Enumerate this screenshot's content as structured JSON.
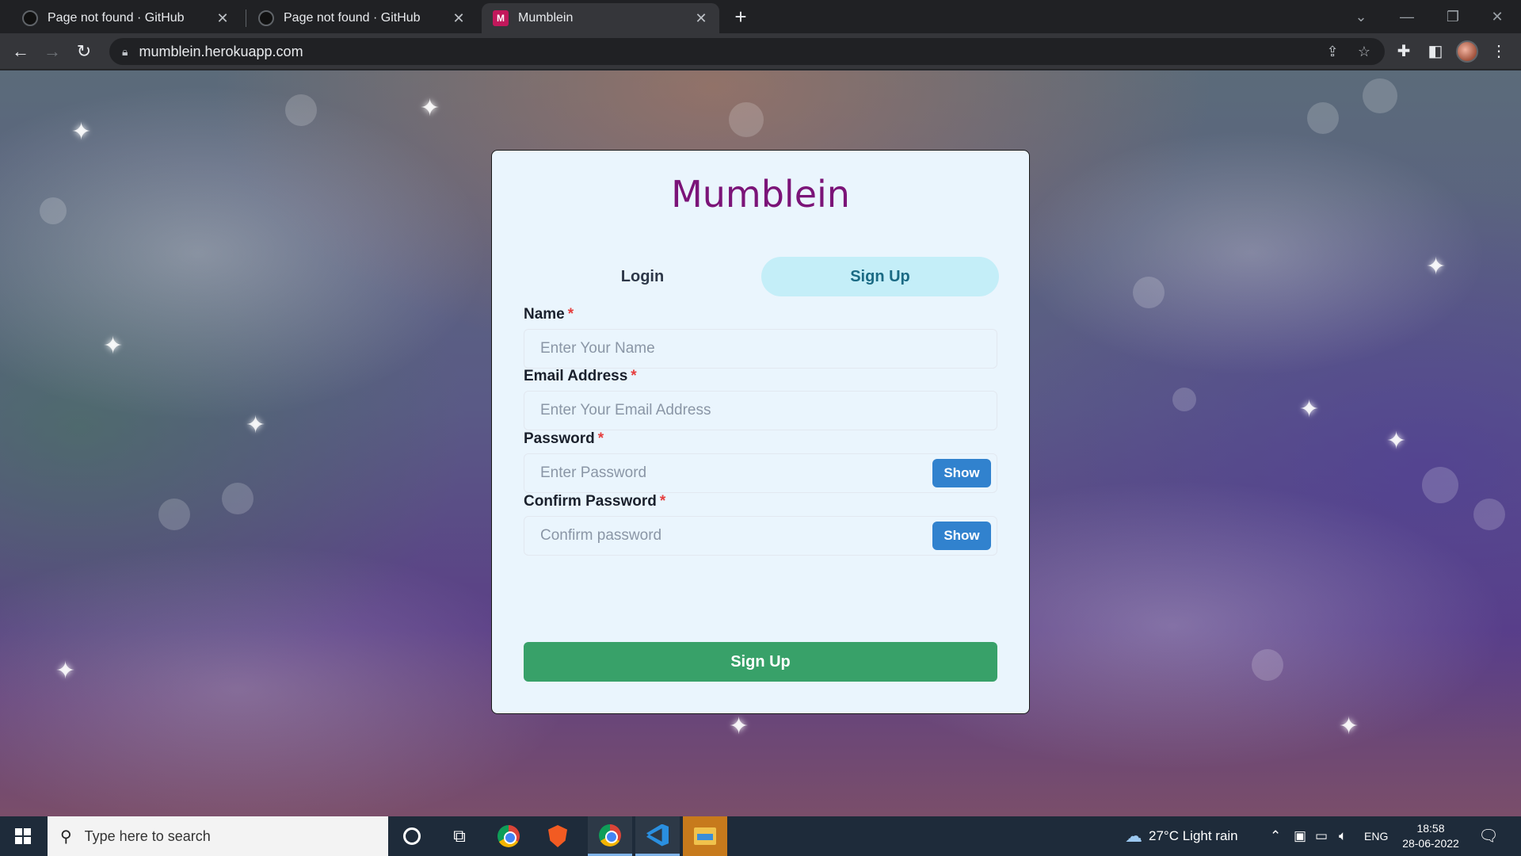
{
  "browser": {
    "tabs": [
      {
        "title": "Page not found · GitHub",
        "active": false
      },
      {
        "title": "Page not found · GitHub",
        "active": false
      },
      {
        "title": "Mumblein",
        "active": true
      }
    ],
    "url": "mumblein.herokuapp.com"
  },
  "app": {
    "brand": "Mumblein",
    "tabs": {
      "login": "Login",
      "signup": "Sign Up"
    },
    "fields": [
      {
        "label": "Name",
        "required": "*",
        "placeholder": "Enter Your Name"
      },
      {
        "label": "Email Address",
        "required": "*",
        "placeholder": "Enter Your Email Address"
      },
      {
        "label": "Password",
        "required": "*",
        "placeholder": "Enter Password",
        "toggle": "Show"
      },
      {
        "label": "Confirm Password",
        "required": "*",
        "placeholder": "Confirm password",
        "toggle": "Show"
      }
    ],
    "submit_label": "Sign Up",
    "colors": {
      "brand": "#7b1478",
      "primary": "#3182ce",
      "submit": "#38a169",
      "active_tab_bg": "#c4eef8"
    }
  },
  "taskbar": {
    "search_placeholder": "Type here to search",
    "weather": "27°C  Light rain",
    "language": "ENG",
    "time": "18:58",
    "date": "28-06-2022"
  }
}
